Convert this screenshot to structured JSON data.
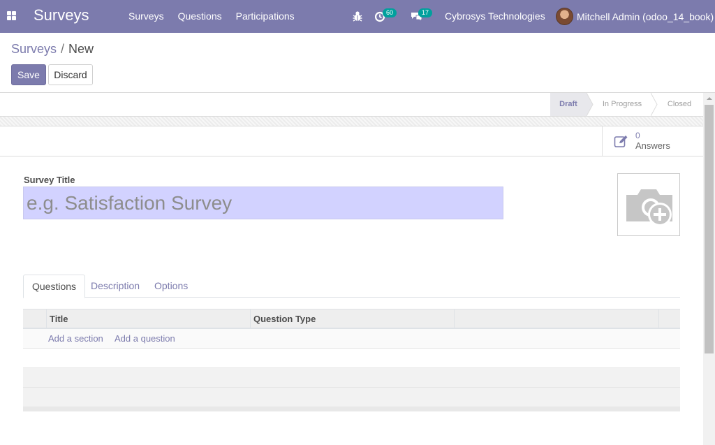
{
  "navbar": {
    "app_name": "Surveys",
    "menu": [
      "Surveys",
      "Questions",
      "Participations"
    ],
    "activity_count": "60",
    "messages_count": "17",
    "company": "Cybrosys Technologies",
    "user": "Mitchell Admin (odoo_14_book)",
    "bg_color": "#7c7bad"
  },
  "breadcrumb": {
    "parent": "Surveys",
    "current": "New"
  },
  "buttons": {
    "save": "Save",
    "discard": "Discard"
  },
  "statusbar": {
    "stages": [
      "Draft",
      "In Progress",
      "Closed"
    ],
    "active": "Draft"
  },
  "stat_button": {
    "value": "0",
    "label": "Answers"
  },
  "form": {
    "title_label": "Survey Title",
    "title_placeholder": "e.g. Satisfaction Survey",
    "title_value": ""
  },
  "tabs": [
    "Questions",
    "Description",
    "Options"
  ],
  "table": {
    "columns": [
      "Title",
      "Question Type"
    ],
    "add_section": "Add a section",
    "add_question": "Add a question"
  },
  "icons": {
    "apps": "apps-grid-icon",
    "bug": "bug-icon",
    "activity": "clock-icon",
    "messages": "chat-bubbles-icon",
    "stat": "edit-icon",
    "image": "camera-plus-icon"
  }
}
